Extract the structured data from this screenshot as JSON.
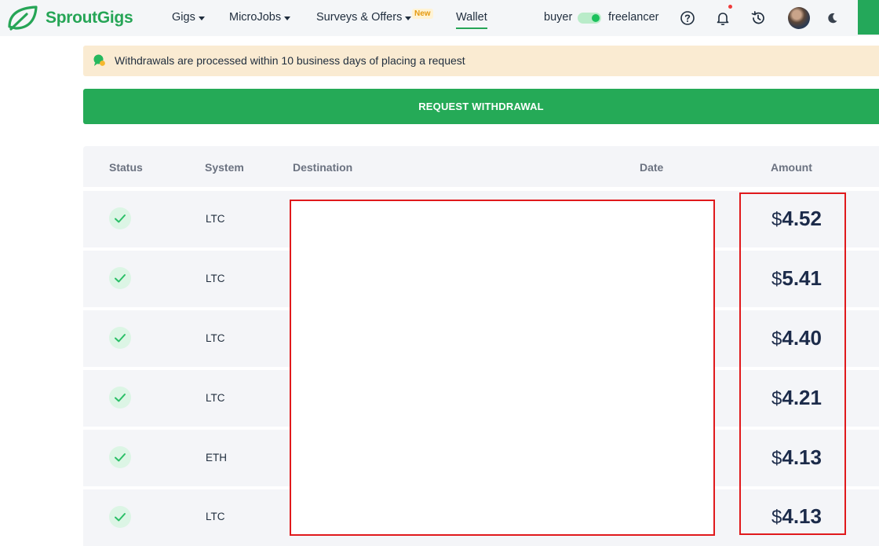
{
  "brand": {
    "name": "SproutGigs",
    "color": "#26a556"
  },
  "nav": {
    "gigs": "Gigs",
    "microjobs": "MicroJobs",
    "surveys": "Surveys & Offers",
    "new_badge": "New",
    "wallet": "Wallet"
  },
  "mode": {
    "left": "buyer",
    "right": "freelancer",
    "active": "freelancer"
  },
  "header_icons": [
    "help-icon",
    "bell-icon",
    "history-icon",
    "avatar",
    "moon-icon"
  ],
  "notice": {
    "text": "Withdrawals are processed within 10 business days of placing a request"
  },
  "request_button": "REQUEST WITHDRAWAL",
  "table": {
    "headers": {
      "status": "Status",
      "system": "System",
      "destination": "Destination",
      "date": "Date",
      "amount": "Amount"
    },
    "rows": [
      {
        "status": "completed",
        "system": "LTC",
        "currency": "$",
        "amount": "4.52"
      },
      {
        "status": "completed",
        "system": "LTC",
        "currency": "$",
        "amount": "5.41"
      },
      {
        "status": "completed",
        "system": "LTC",
        "currency": "$",
        "amount": "4.40"
      },
      {
        "status": "completed",
        "system": "LTC",
        "currency": "$",
        "amount": "4.21"
      },
      {
        "status": "completed",
        "system": "ETH",
        "currency": "$",
        "amount": "4.13"
      },
      {
        "status": "completed",
        "system": "LTC",
        "currency": "$",
        "amount": "4.13"
      }
    ]
  },
  "colors": {
    "accent": "#26a556",
    "highlight": "#e0191c",
    "notice_bg": "#faebd2"
  }
}
